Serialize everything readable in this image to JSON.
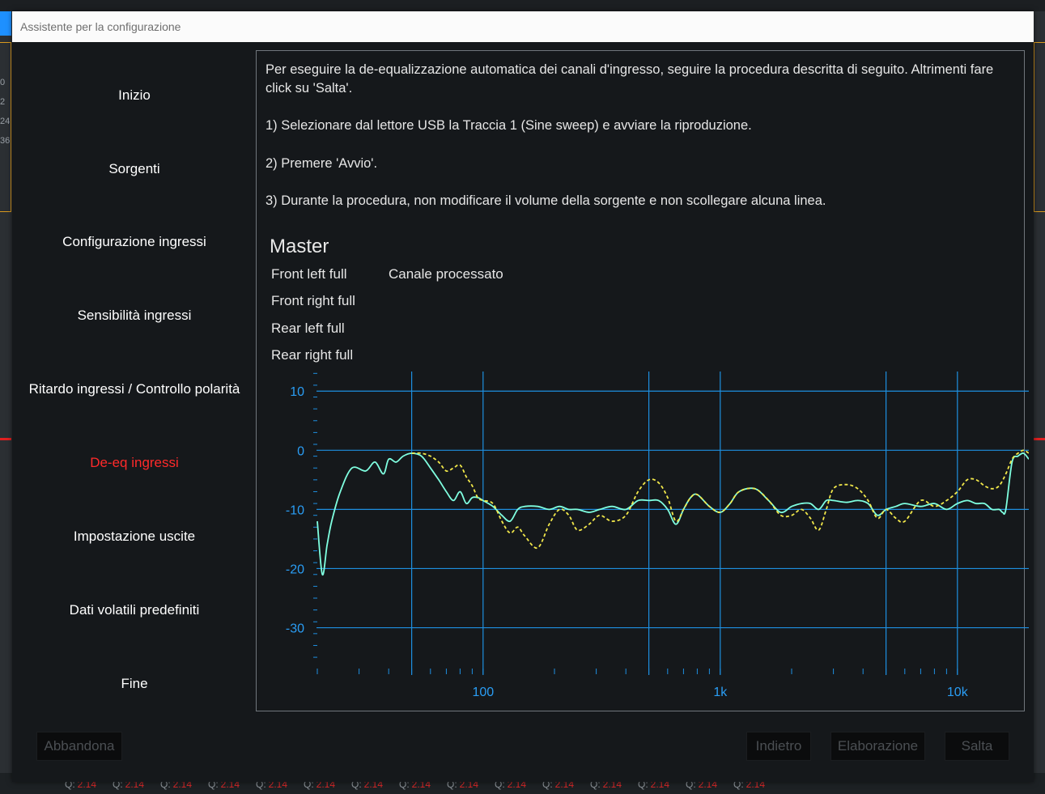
{
  "window": {
    "title": "Assistente per la configurazione"
  },
  "nav": {
    "items": [
      {
        "label": "Inizio",
        "active": false
      },
      {
        "label": "Sorgenti",
        "active": false
      },
      {
        "label": "Configurazione ingressi",
        "active": false
      },
      {
        "label": "Sensibilità ingressi",
        "active": false
      },
      {
        "label": "Ritardo ingressi / Controllo polarità",
        "active": false
      },
      {
        "label": "De-eq ingressi",
        "active": true
      },
      {
        "label": "Impostazione uscite",
        "active": false
      },
      {
        "label": "Dati volatili predefiniti",
        "active": false
      },
      {
        "label": "Fine",
        "active": false
      }
    ]
  },
  "instructions": {
    "intro": "Per eseguire la de-equalizzazione automatica dei canali d'ingresso, seguire la procedura descritta di seguito. Altrimenti fare click su 'Salta'.",
    "step1": "1) Selezionare dal lettore USB la Traccia 1 (Sine sweep) e avviare la riproduzione.",
    "step2": "2) Premere 'Avvio'.",
    "step3": "3) Durante la procedura, non modificare il volume della sorgente e non scollegare alcuna linea."
  },
  "group": {
    "title": "Master",
    "channels": [
      "Front left full",
      "Front right full",
      "Rear left full",
      "Rear right full"
    ],
    "processed_label": "Canale processato"
  },
  "buttons": {
    "abandon": "Abbandona",
    "back": "Indietro",
    "process": "Elaborazione",
    "skip": "Salta"
  },
  "background": {
    "left_ticks": [
      "0",
      "2",
      "24",
      "36"
    ],
    "q_label": "Q:",
    "q_value": "2.14"
  },
  "chart_data": {
    "type": "line",
    "x_scale": "log",
    "xlim": [
      20,
      20000
    ],
    "ylim": [
      -38,
      14
    ],
    "yticks": [
      10,
      0,
      -10,
      -20,
      -30
    ],
    "ytick_labels": [
      "10",
      "0",
      "-10",
      "-20",
      "-30"
    ],
    "xticks": [
      100,
      1000,
      10000
    ],
    "xtick_labels": [
      "100",
      "1k",
      "10k"
    ],
    "major_x_gridlines": [
      50,
      100,
      500,
      1000,
      5000,
      10000
    ],
    "grid": true,
    "colors": {
      "measured": "#7fffe0",
      "processed": "#f2e84a",
      "grid": "#1e8fe0",
      "labels": "#2a9df4"
    },
    "series": [
      {
        "style": "solid",
        "x": [
          20,
          21,
          22,
          23,
          25,
          28,
          32,
          35,
          38,
          40,
          43,
          46,
          50,
          55,
          60,
          65,
          70,
          75,
          80,
          85,
          90,
          95,
          100,
          110,
          120,
          130,
          140,
          150,
          170,
          190,
          210,
          230,
          250,
          280,
          310,
          350,
          400,
          450,
          500,
          550,
          600,
          650,
          700,
          750,
          800,
          900,
          1000,
          1100,
          1200,
          1400,
          1600,
          1800,
          2000,
          2200,
          2400,
          2600,
          2800,
          3000,
          3400,
          3800,
          4200,
          4600,
          5000,
          5500,
          6000,
          7000,
          8000,
          9000,
          10000,
          11000,
          12000,
          13000,
          14000,
          15000,
          15500,
          16000,
          17000,
          18000,
          19000,
          20000
        ],
        "y": [
          -12,
          -21,
          -16,
          -12,
          -7,
          -3,
          -3.5,
          -2,
          -4,
          -1.5,
          -2,
          -1,
          -0.5,
          -1,
          -3,
          -5,
          -7,
          -8.5,
          -7,
          -9,
          -8,
          -8,
          -8.5,
          -9.5,
          -11,
          -12,
          -10,
          -9.5,
          -9.5,
          -10,
          -9.5,
          -10,
          -10,
          -10.5,
          -10,
          -9.5,
          -10,
          -8.5,
          -8.5,
          -8.5,
          -10,
          -12.5,
          -10,
          -8,
          -7.5,
          -9.5,
          -10.5,
          -9,
          -7,
          -6.5,
          -8.5,
          -10.5,
          -9.5,
          -9,
          -9,
          -10,
          -8.5,
          -8.5,
          -8.8,
          -8.5,
          -9,
          -11,
          -10,
          -9.5,
          -9,
          -9.5,
          -9,
          -10,
          -9,
          -8.5,
          -9,
          -9,
          -10,
          -10,
          -10.5,
          -10,
          -2,
          -1,
          -0.5,
          -1.5
        ]
      },
      {
        "style": "dashed",
        "x": [
          50,
          55,
          60,
          65,
          70,
          75,
          80,
          85,
          90,
          95,
          100,
          110,
          120,
          130,
          140,
          150,
          170,
          190,
          210,
          230,
          250,
          280,
          310,
          350,
          400,
          450,
          500,
          550,
          600,
          650,
          700,
          750,
          800,
          900,
          1000,
          1100,
          1200,
          1400,
          1600,
          1800,
          2000,
          2200,
          2400,
          2600,
          2800,
          3000,
          3400,
          3800,
          4200,
          4600,
          5000,
          5500,
          6000,
          7000,
          8000,
          9000,
          10000,
          11000,
          12000,
          13000,
          14000,
          15000,
          16000,
          17000,
          18000,
          19000,
          20000
        ],
        "y": [
          -0.5,
          -0.5,
          -1,
          -2,
          -3.5,
          -3,
          -2.5,
          -4.5,
          -6,
          -8,
          -8.5,
          -9,
          -12,
          -14,
          -13,
          -14.5,
          -16.5,
          -12.5,
          -10,
          -11,
          -13.5,
          -12.5,
          -11,
          -12,
          -11,
          -7,
          -5,
          -5.5,
          -8,
          -12,
          -10,
          -8,
          -7.5,
          -9.5,
          -10.5,
          -9,
          -7,
          -6.5,
          -8.5,
          -11,
          -11,
          -10,
          -11.5,
          -13.5,
          -10,
          -6.5,
          -5.8,
          -6.5,
          -8.5,
          -11.5,
          -10,
          -11.5,
          -12,
          -8.5,
          -9.5,
          -8.5,
          -7,
          -5,
          -5,
          -6,
          -6.5,
          -6,
          -4,
          -1.5,
          -0.5,
          0,
          -0.5
        ]
      }
    ]
  }
}
